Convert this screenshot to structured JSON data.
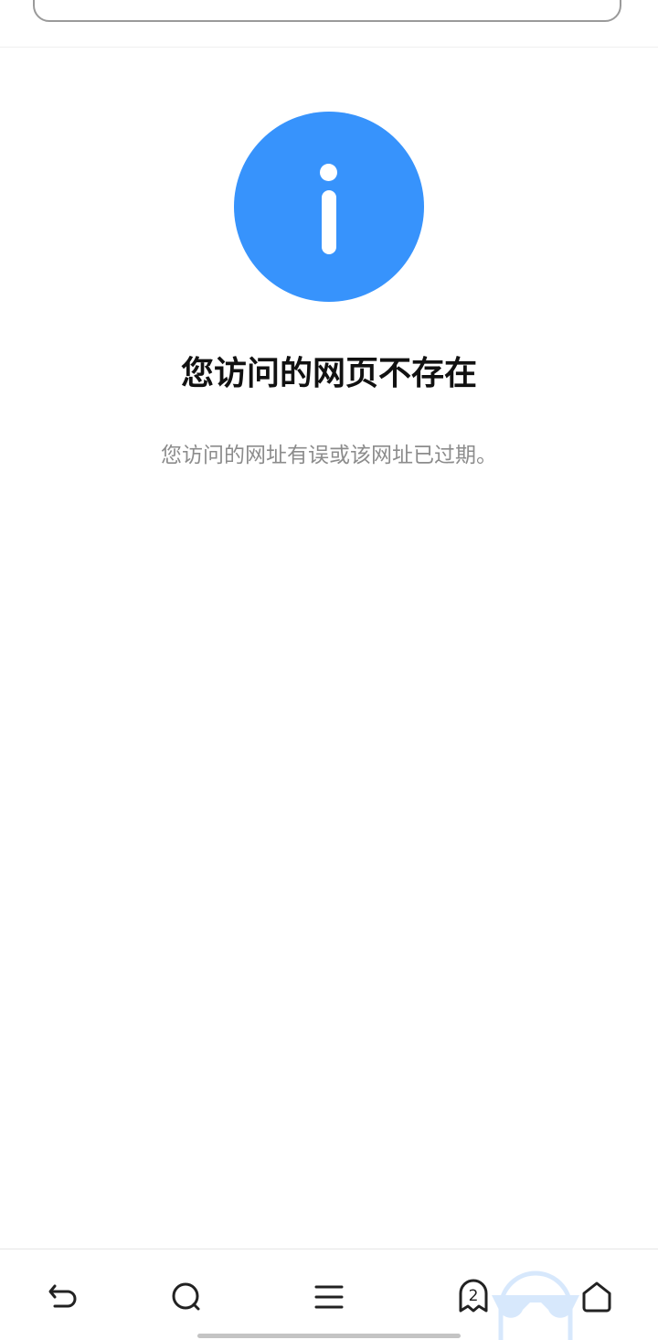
{
  "error": {
    "title": "您访问的网页不存在",
    "description": "您访问的网址有误或该网址已过期。"
  },
  "bottom_nav": {
    "tab_count": "2",
    "icons": [
      "back-icon",
      "search-icon",
      "menu-icon",
      "tabs-icon",
      "home-icon"
    ]
  },
  "colors": {
    "accent": "#3793fc",
    "title_text": "#111111",
    "description_text": "#8c8c8c"
  }
}
